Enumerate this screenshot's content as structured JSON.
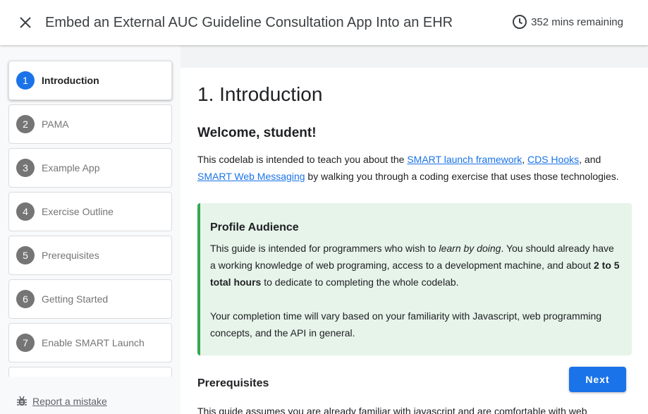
{
  "header": {
    "title": "Embed an External AUC Guideline Consultation App Into an EHR",
    "time_remaining": "352 mins remaining"
  },
  "sidebar": {
    "steps": [
      {
        "number": "1",
        "label": "Introduction",
        "active": true
      },
      {
        "number": "2",
        "label": "PAMA"
      },
      {
        "number": "3",
        "label": "Example App"
      },
      {
        "number": "4",
        "label": "Exercise Outline"
      },
      {
        "number": "5",
        "label": "Prerequisites"
      },
      {
        "number": "6",
        "label": "Getting Started"
      },
      {
        "number": "7",
        "label": "Enable SMART Launch"
      }
    ],
    "report_label": "Report a mistake"
  },
  "content": {
    "heading": "1. Introduction",
    "welcome": "Welcome, student!",
    "intro": {
      "before": "This codelab is intended to teach you about the ",
      "link1": "SMART launch framework",
      "sep1": ", ",
      "link2": "CDS Hooks",
      "sep2": ", and ",
      "link3": "SMART Web Messaging",
      "after": " by walking you through a coding exercise that uses those technologies."
    },
    "callout": {
      "title": "Profile Audience",
      "p1_a": "This guide is intended for programmers who wish to ",
      "p1_em": "learn by doing",
      "p1_b": ". You should already have a working knowledge of web programing, access to a development machine, and about ",
      "p1_strong": "2 to 5 total hours",
      "p1_c": " to dedicate to completing the whole codelab.",
      "p2": "Your completion time will vary based on your familiarity with Javascript, web programming concepts, and the API in general."
    },
    "prereq_heading": "Prerequisites",
    "prereq_text": "This guide assumes you are already familiar with javascript and are comfortable with web"
  },
  "next_label": "Next"
}
